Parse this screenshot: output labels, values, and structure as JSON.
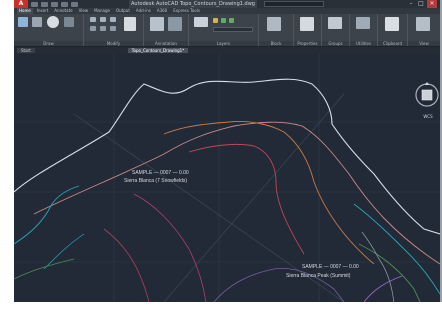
{
  "window": {
    "title": "Autodesk AutoCAD  Topo_Contours_Drawing1.dwg",
    "minimize": "–",
    "maximize": "□",
    "close": "✕"
  },
  "ribbon_tabs": [
    "Home",
    "Insert",
    "Annotate",
    "View",
    "Manage",
    "Output",
    "Add-ins",
    "A360",
    "Express Tools"
  ],
  "ribbon_panels": [
    "Draw",
    "Modify",
    "Annotation",
    "Layers",
    "Block",
    "Properties",
    "Groups",
    "Utilities",
    "Clipboard",
    "View"
  ],
  "file_tabs": [
    "Start",
    "Topo_Contours_Drawing1*"
  ],
  "annotations": {
    "label_a_line1": "SAMPLE — 0007 — 0.00",
    "label_a_line2": "Sierra Blanca (7 Snowfields)",
    "label_b_line1": "SAMPLE — 0007 — 0.00",
    "label_b_line2": "Sierra Blanca Peak (Summit)"
  },
  "viewcube": {
    "label": "TOP",
    "wcs": "WCS"
  },
  "colors": {
    "background": "#212a36",
    "contour_white": "#d8dee6",
    "contour_orange": "#c77a4a",
    "contour_red": "#c2455a",
    "contour_cyan": "#2aa3b8",
    "contour_green": "#4e8c55",
    "contour_purple": "#7a5da3",
    "grid": "#3a4452"
  }
}
